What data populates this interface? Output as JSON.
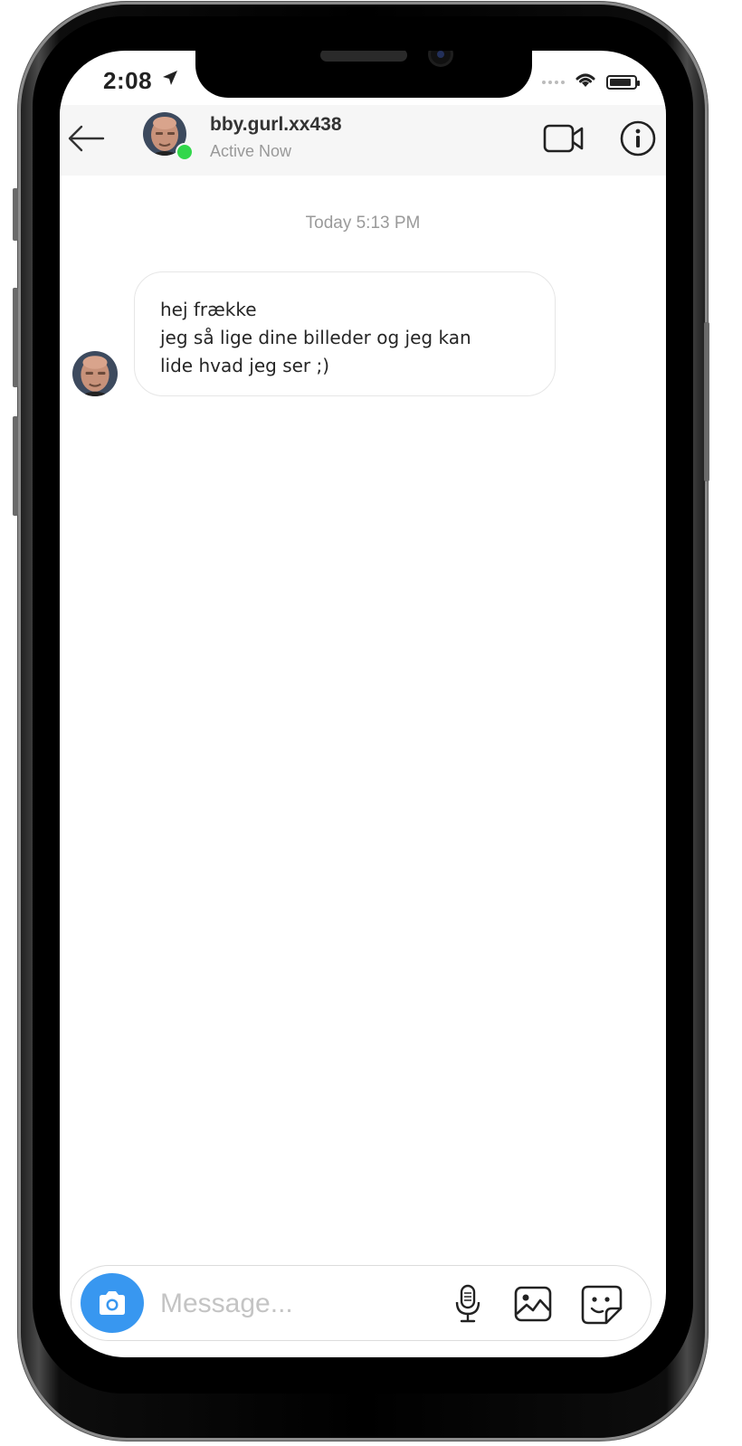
{
  "status_bar": {
    "time": "2:08",
    "location_icon": "location-arrow-icon",
    "signal_icon": "cellular-signal-icon",
    "wifi_icon": "wifi-icon",
    "battery_icon": "battery-icon"
  },
  "header": {
    "back_icon": "back-arrow-icon",
    "avatar_icon": "profile-avatar",
    "username": "bby.gurl.xx438",
    "active_status": "Active Now",
    "online_color": "#32d74b",
    "video_icon": "video-camera-icon",
    "info_icon": "info-icon"
  },
  "conversation": {
    "timestamp": "Today 5:13 PM",
    "messages": [
      {
        "sender_avatar": "profile-avatar",
        "lines": [
          "hej frække",
          "jeg så lige dine billeder og jeg kan",
          "lide hvad jeg ser ;)"
        ]
      }
    ]
  },
  "composer": {
    "camera_icon": "camera-icon",
    "placeholder": "Message...",
    "value": "",
    "mic_icon": "microphone-icon",
    "gallery_icon": "image-gallery-icon",
    "sticker_icon": "sticker-icon",
    "accent_color": "#3897f0"
  }
}
